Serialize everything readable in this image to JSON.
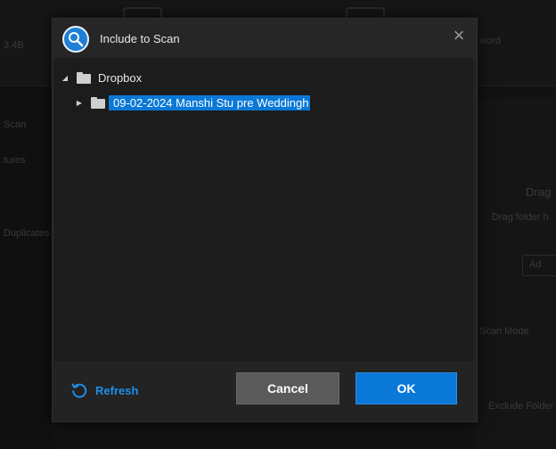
{
  "background": {
    "texts": [
      "3.4B",
      "word",
      "Scan",
      "tures",
      "Duplicates",
      "Drag",
      "Drag folder h",
      "Ad",
      "Scan Mode",
      "Exclude Folder"
    ]
  },
  "dialog": {
    "title": "Include to Scan",
    "app_icon": "magnifier-scan-icon",
    "close_icon": "close-icon",
    "tree": {
      "root": {
        "label": "Dropbox",
        "expanded": true
      },
      "children": [
        {
          "label": "09-02-2024 Manshi Stu pre Weddingh",
          "expanded": false,
          "selected": true
        }
      ]
    },
    "footer": {
      "refresh_label": "Refresh",
      "cancel_label": "Cancel",
      "ok_label": "OK"
    }
  },
  "colors": {
    "accent": "#0a78d7",
    "link": "#1e8ee8",
    "dialog_bg": "#232323",
    "tree_bg": "#1c1c1c"
  }
}
